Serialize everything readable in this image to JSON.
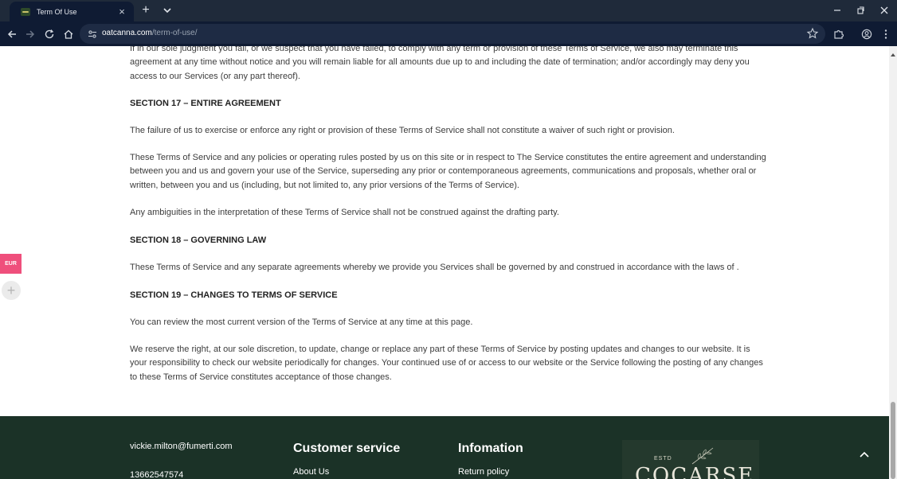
{
  "browser": {
    "tab_title": "Term Of Use",
    "url_host": "oatcanna.com",
    "url_path": "/term-of-use/"
  },
  "content": {
    "intro_paragraph": "If in our sole judgment you fail, or we suspect that you have failed, to comply with any term or provision of these Terms of Service, we also may terminate this agreement at any time without notice and you will remain liable for all amounts due up to and including the date of termination; and/or accordingly may deny you access to our Services (or any part thereof).",
    "section17_title": "SECTION 17 – ENTIRE AGREEMENT",
    "section17_p1": "The failure of us to exercise or enforce any right or provision of these Terms of Service shall not constitute a waiver of such right or provision.",
    "section17_p2": "These Terms of Service and any policies or operating rules posted by us on this site or in respect to The Service constitutes the entire agreement and understanding between you and us and govern your use of the Service, superseding any prior or contemporaneous agreements, communications and proposals, whether oral or written, between you and us (including, but not limited to, any prior versions of the Terms of Service).",
    "section17_p3": "Any ambiguities in the interpretation of these Terms of Service shall not be construed against the drafting party.",
    "section18_title": "SECTION 18 – GOVERNING LAW",
    "section18_p1": "These Terms of Service and any separate agreements whereby we provide you Services shall be governed by and construed in accordance with the laws of .",
    "section19_title": "SECTION 19 – CHANGES TO TERMS OF SERVICE",
    "section19_p1": "You can review the most current version of the Terms of Service at any time at this page.",
    "section19_p2": "We reserve the right, at our sole discretion, to update, change or replace any part of these Terms of Service by posting updates and changes to our website. It is your responsibility to check our website periodically for changes. Your continued use of or access to our website or the Service following the posting of any changes to these Terms of Service constitutes acceptance of those changes."
  },
  "footer": {
    "email": "vickie.milton@fumerti.com",
    "phone": "13662547574",
    "customer_service_heading": "Customer service",
    "customer_service_link": "About Us",
    "information_heading": "Infomation",
    "information_link": "Return policy",
    "logo_estd": "ESTD",
    "logo_brand": "COCARSE"
  },
  "widgets": {
    "currency_label": "EUR"
  },
  "colors": {
    "browser_frame": "#0f1b33",
    "footer_bg": "#1b3227",
    "currency_badge": "#ef4f7c"
  }
}
